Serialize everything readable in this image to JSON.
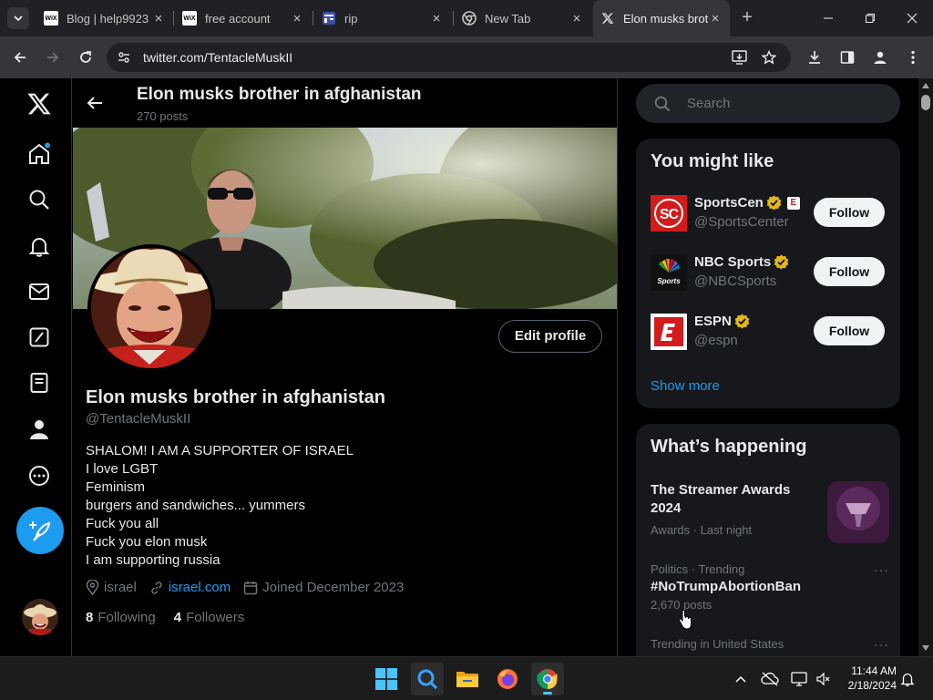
{
  "browser": {
    "tabs": [
      {
        "title": "Blog | help9923",
        "favicon": "wix-icon",
        "fav_text": "WiX",
        "active": false
      },
      {
        "title": "free account",
        "favicon": "wix-icon",
        "fav_text": "WiX",
        "active": false
      },
      {
        "title": "rip",
        "favicon": "page-icon",
        "active": false
      },
      {
        "title": "New Tab",
        "favicon": "chrome-icon",
        "active": false
      },
      {
        "title": "Elon musks brother",
        "favicon": "x-logo-icon",
        "active": true
      }
    ],
    "new_tab": "+",
    "close": "×",
    "url": "twitter.com/TentacleMuskII"
  },
  "profile": {
    "header_name": "Elon musks brother in afghanistan",
    "posts_count": "270 posts",
    "edit_profile": "Edit profile",
    "name": "Elon musks brother in afghanistan",
    "handle": "@TentacleMuskII",
    "bio": [
      "SHALOM! I AM A SUPPORTER OF ISRAEL",
      "I love LGBT",
      "Feminism",
      "burgers and sandwiches... yummers",
      "Fuck you all",
      "Fuck you elon musk",
      "I am supporting russia"
    ],
    "location": "israel",
    "website": "israel.com",
    "joined": "Joined December 2023",
    "following_count": "8",
    "following_label": "Following",
    "followers_count": "4",
    "followers_label": "Followers"
  },
  "search": {
    "placeholder": "Search"
  },
  "you_might_like": {
    "title": "You might like",
    "items": [
      {
        "name": "SportsCen",
        "handle": "@SportsCenter",
        "follow": "Follow",
        "verified": true,
        "extra_badge": "E"
      },
      {
        "name": "NBC Sports",
        "handle": "@NBCSports",
        "follow": "Follow",
        "verified": true
      },
      {
        "name": "ESPN",
        "handle": "@espn",
        "follow": "Follow",
        "verified": true
      }
    ],
    "show_more": "Show more"
  },
  "whats_happening": {
    "title": "What’s happening",
    "items": [
      {
        "title": "The Streamer Awards 2024",
        "meta": "Awards · Last night"
      },
      {
        "meta": "Politics · Trending",
        "title": "#NoTrumpAbortionBan",
        "count": "2,670 posts",
        "more": "···"
      },
      {
        "meta": "Trending in United States",
        "more": "···"
      }
    ]
  },
  "taskbar": {
    "time": "11:44 AM",
    "date": "2/18/2024"
  },
  "colors": {
    "accent": "#1d9bf0",
    "verified": "#e2b719",
    "bg": "#000000"
  }
}
